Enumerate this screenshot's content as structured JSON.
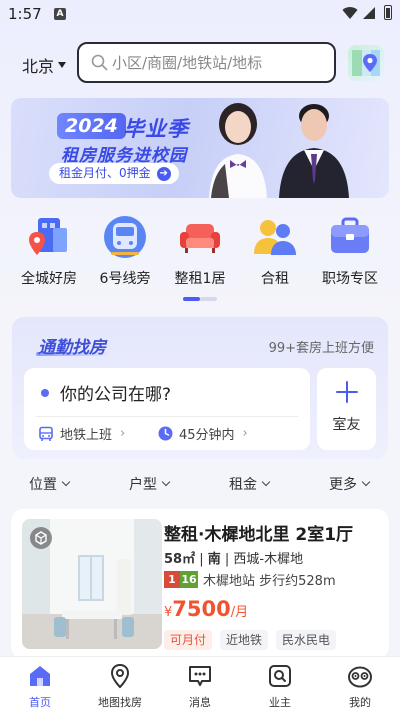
{
  "status_bar": {
    "time": "1:57",
    "notification_icon": "A"
  },
  "header": {
    "city": "北京",
    "search_placeholder": "小区/商圈/地铁站/地标"
  },
  "banner": {
    "year": "2024",
    "title": "毕业季",
    "subtitle": "租房服务进校园",
    "pill_text": "租金月付、0押金"
  },
  "quick_nav": {
    "items": [
      {
        "label": "全城好房",
        "icon": "city-house-icon"
      },
      {
        "label": "6号线旁",
        "icon": "subway-train-icon"
      },
      {
        "label": "整租1居",
        "icon": "sofa-icon"
      },
      {
        "label": "合租",
        "icon": "roommates-icon"
      },
      {
        "label": "职场专区",
        "icon": "briefcase-icon"
      }
    ]
  },
  "commute": {
    "title": "通勤找房",
    "count_text": "99+套房上班方便",
    "question": "你的公司在哪?",
    "option_transport": "地铁上班",
    "option_time": "45分钟内",
    "roommate_label": "室友"
  },
  "filters": [
    "位置",
    "户型",
    "租金",
    "更多"
  ],
  "listing": {
    "title": "整租·木樨地北里 2室1厅",
    "area": "58㎡",
    "orientation": "南",
    "district": "西城-木樨地",
    "line_a": "1",
    "line_b": "16",
    "metro_text": "木樨地站 步行约528m",
    "price_symbol": "¥",
    "price": "7500",
    "price_unit": "/月",
    "tags": [
      "可月付",
      "近地铁",
      "民水民电"
    ]
  },
  "bottom_nav": {
    "items": [
      {
        "label": "首页",
        "active": true
      },
      {
        "label": "地图找房",
        "active": false
      },
      {
        "label": "消息",
        "active": false
      },
      {
        "label": "业主",
        "active": false
      },
      {
        "label": "我的",
        "active": false
      }
    ]
  },
  "colors": {
    "accent": "#4a5cf2",
    "price": "#f0542f",
    "line1": "#d84a3a",
    "line16": "#5fa234"
  }
}
